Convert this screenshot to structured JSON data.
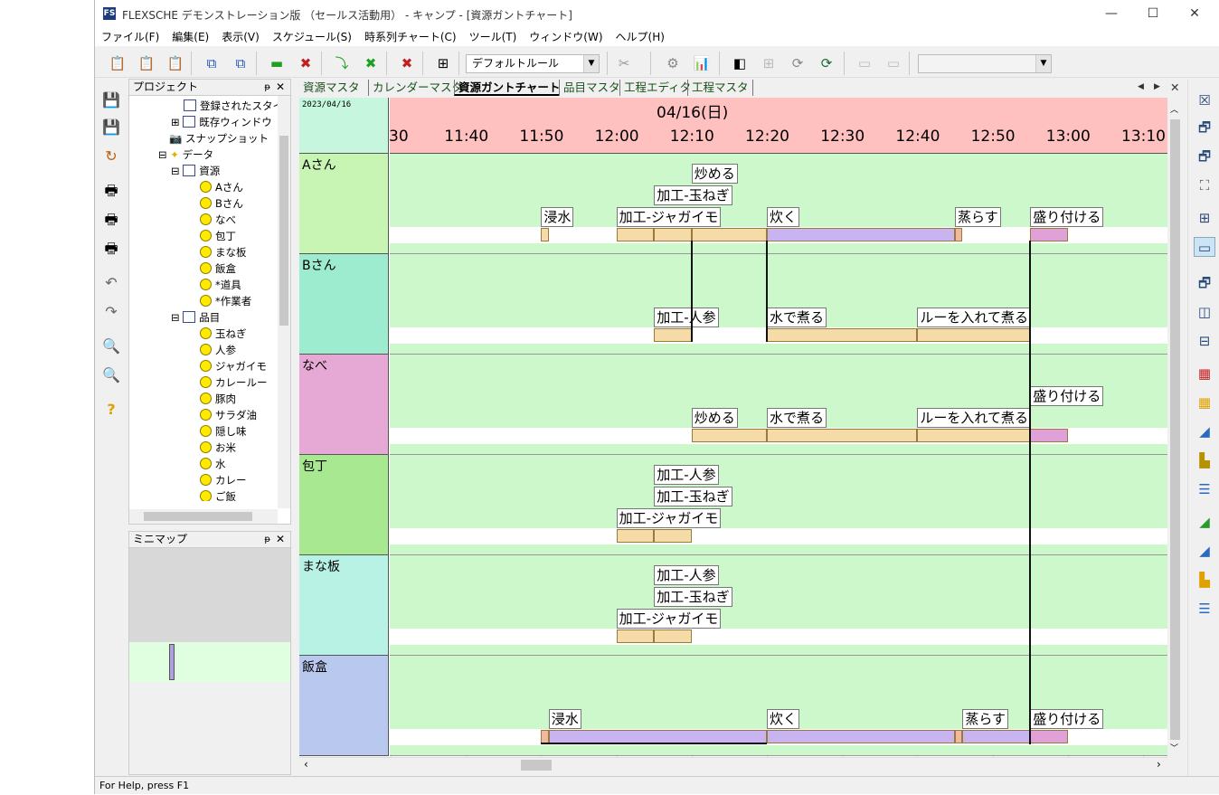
{
  "window": {
    "logo": "FS",
    "title": "FLEXSCHE デモンストレーション版 （セールス活動用） - キャンプ - [資源ガントチャート]",
    "minimize": "—",
    "maximize": "☐",
    "close": "✕"
  },
  "menu": [
    "ファイル(F)",
    "編集(E)",
    "表示(V)",
    "スケジュール(S)",
    "時系列チャート(C)",
    "ツール(T)",
    "ウィンドウ(W)",
    "ヘルプ(H)"
  ],
  "toolbar": {
    "rule_combo": "デフォルトルール",
    "empty_combo": ""
  },
  "project_panel": {
    "title": "プロジェクト",
    "pin": "ᵽ",
    "close": "✕",
    "tree": {
      "registered_styles": "登録されたスタイ",
      "existing_windows": "既存ウィンドウ",
      "snapshot": "スナップショット",
      "data": "データ",
      "resources": "資源",
      "resource_items": [
        "Aさん",
        "Bさん",
        "なべ",
        "包丁",
        "まな板",
        "飯盒",
        "*道具",
        "*作業者"
      ],
      "items": "品目",
      "item_list": [
        "玉ねぎ",
        "人参",
        "ジャガイモ",
        "カレールー",
        "豚肉",
        "サラダ油",
        "隠し味",
        "お米",
        "水",
        "カレー",
        "ご飯"
      ]
    }
  },
  "minimap_panel": {
    "title": "ミニマップ",
    "pin": "ᵽ",
    "close": "✕"
  },
  "tabs": [
    "資源マスタ",
    "カレンダーマスタ",
    "資源ガントチャート",
    "品目マスタ",
    "工程エディタ",
    "工程マスタ"
  ],
  "active_tab": "資源ガントチャート",
  "tab_nav": {
    "prev": "◀",
    "next": "▶",
    "close": "✕"
  },
  "gantt": {
    "date": "2023/04/16",
    "day": "04/16(日)",
    "ticks": [
      "30",
      "11:40",
      "11:50",
      "12:00",
      "12:10",
      "12:20",
      "12:30",
      "12:40",
      "12:50",
      "13:00",
      "13:10"
    ],
    "resources": [
      {
        "name": "Aさん",
        "color": "#c8f5b4"
      },
      {
        "name": "Bさん",
        "color": "#9eecd0"
      },
      {
        "name": "なべ",
        "color": "#e6a8d4"
      },
      {
        "name": "包丁",
        "color": "#a8e890"
      },
      {
        "name": "まな板",
        "color": "#b8f2e4"
      },
      {
        "name": "飯盒",
        "color": "#b8c8ee"
      }
    ],
    "labels": {
      "a_saute": "炒める",
      "a_onion": "加工-玉ねぎ",
      "a_soak": "浸水",
      "a_potato": "加工-ジャガイモ",
      "a_cook": "炊く",
      "a_steam": "蒸らす",
      "a_serve": "盛り付ける",
      "b_carrot": "加工-人参",
      "b_boil": "水で煮る",
      "b_roux": "ルーを入れて煮る",
      "n_serve": "盛り付ける",
      "n_saute": "炒める",
      "n_boil": "水で煮る",
      "n_roux": "ルーを入れて煮る",
      "k_carrot": "加工-人参",
      "k_onion": "加工-玉ねぎ",
      "k_potato": "加工-ジャガイモ",
      "m_carrot": "加工-人参",
      "m_onion": "加工-玉ねぎ",
      "m_potato": "加工-ジャガイモ",
      "h_soak": "浸水",
      "h_cook": "炊く",
      "h_steam": "蒸らす",
      "h_serve": "盛り付ける"
    }
  },
  "colors": {
    "task": "#f5dba8",
    "cook": "#c8b4f0",
    "serve": "#e0a0d8",
    "steam": "#f0b8a0",
    "lane": "#ccf8cc",
    "header": "#ffc0c0"
  },
  "status_bar": "For Help, press F1"
}
